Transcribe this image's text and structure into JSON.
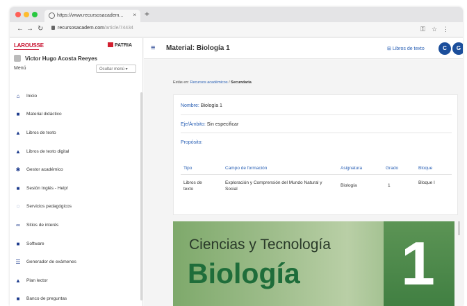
{
  "browser": {
    "tab_title": "https://www.recursosacadem...",
    "tab_close": "×",
    "new_tab": "+",
    "url_host": "recursosacadem.com",
    "url_path": "/article/74434",
    "colors": {
      "red": "#ff5f57",
      "yellow": "#febc2e",
      "green": "#28c840"
    }
  },
  "sidebar": {
    "logo_left": "LAROUSSE",
    "logo_right": "PATRIA",
    "user_name": "Victor Hugo Acosta Reeyes",
    "menu_label": "Menú",
    "menu_select": "Ocultar menú ▾",
    "items": [
      {
        "label": "Inicio",
        "icon": "home-icon"
      },
      {
        "label": "Material didáctico",
        "icon": "list-icon"
      },
      {
        "label": "Libros de texto",
        "icon": "book-icon"
      },
      {
        "label": "Libros de texto digital",
        "icon": "book-icon"
      },
      {
        "label": "Gestor académico",
        "icon": "users-icon"
      },
      {
        "label": "Sesión Inglés - Help!",
        "icon": "list-icon"
      },
      {
        "label": "Servicios pedagógicos",
        "icon": "chat-icon"
      },
      {
        "label": "Sitios de interés",
        "icon": "link-icon"
      },
      {
        "label": "Software",
        "icon": "square-icon"
      },
      {
        "label": "Generador de exámenes",
        "icon": "grid-icon"
      },
      {
        "label": "Plan lector",
        "icon": "reader-icon"
      },
      {
        "label": "Banco de preguntas",
        "icon": "list-icon"
      }
    ]
  },
  "header": {
    "title": "Material: Biología 1",
    "textbooks_link": "Libros de texto",
    "icon1": "C",
    "icon2": "G"
  },
  "breadcrumb": {
    "prefix": "Estás en:",
    "link": "Recursos académicos",
    "sep": "/",
    "current": "Secundaria"
  },
  "details": {
    "nombre_label": "Nombre:",
    "nombre_value": "Biología 1",
    "ambito_label": "Eje/Ámbito:",
    "ambito_value": "Sin especificar",
    "proposito_label": "Propósito:"
  },
  "table": {
    "headers": [
      "Tipo",
      "Campo de formación",
      "Asignatura",
      "Grado",
      "Bloque"
    ],
    "row": [
      "Libros de texto",
      "Exploración y Comprensión del Mundo Natural y Social",
      "Biología",
      "1",
      "Bloque I"
    ]
  },
  "cover": {
    "line1": "Ciencias y Tecnología",
    "line2": "Biología",
    "number": "1"
  }
}
